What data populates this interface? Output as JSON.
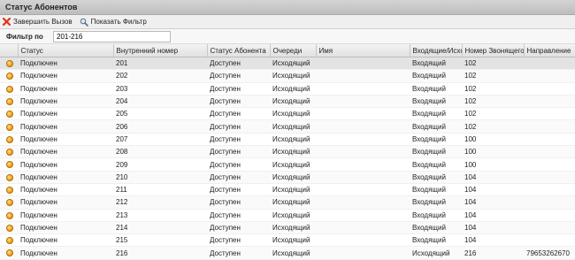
{
  "window": {
    "title": "Статус Абонентов"
  },
  "toolbar": {
    "end_call_label": "Завершить Вызов",
    "show_filter_label": "Показать Фильтр"
  },
  "filter": {
    "label": "Фильтр по",
    "value": "201-216"
  },
  "columns": [
    "Статус",
    "Внутренний номер",
    "Статус Абонента",
    "Очереди",
    "Имя",
    "Входящие/Исходящие",
    "Номер Звонящего",
    "Направление"
  ],
  "rows": [
    {
      "status": "Подключен",
      "ext": "201",
      "subscriber_status": "Доступен",
      "queue": "Исходящий",
      "name": "",
      "direction_type": "Входящий",
      "caller": "102",
      "destination": ""
    },
    {
      "status": "Подключен",
      "ext": "202",
      "subscriber_status": "Доступен",
      "queue": "Исходящий",
      "name": "",
      "direction_type": "Входящий",
      "caller": "102",
      "destination": ""
    },
    {
      "status": "Подключен",
      "ext": "203",
      "subscriber_status": "Доступен",
      "queue": "Исходящий",
      "name": "",
      "direction_type": "Входящий",
      "caller": "102",
      "destination": ""
    },
    {
      "status": "Подключен",
      "ext": "204",
      "subscriber_status": "Доступен",
      "queue": "Исходящий",
      "name": "",
      "direction_type": "Входящий",
      "caller": "102",
      "destination": ""
    },
    {
      "status": "Подключен",
      "ext": "205",
      "subscriber_status": "Доступен",
      "queue": "Исходящий",
      "name": "",
      "direction_type": "Входящий",
      "caller": "102",
      "destination": ""
    },
    {
      "status": "Подключен",
      "ext": "206",
      "subscriber_status": "Доступен",
      "queue": "Исходящий",
      "name": "",
      "direction_type": "Входящий",
      "caller": "102",
      "destination": ""
    },
    {
      "status": "Подключен",
      "ext": "207",
      "subscriber_status": "Доступен",
      "queue": "Исходящий",
      "name": "",
      "direction_type": "Входящий",
      "caller": "100",
      "destination": ""
    },
    {
      "status": "Подключен",
      "ext": "208",
      "subscriber_status": "Доступен",
      "queue": "Исходящий",
      "name": "",
      "direction_type": "Входящий",
      "caller": "100",
      "destination": ""
    },
    {
      "status": "Подключен",
      "ext": "209",
      "subscriber_status": "Доступен",
      "queue": "Исходящий",
      "name": "",
      "direction_type": "Входящий",
      "caller": "100",
      "destination": ""
    },
    {
      "status": "Подключен",
      "ext": "210",
      "subscriber_status": "Доступен",
      "queue": "Исходящий",
      "name": "",
      "direction_type": "Входящий",
      "caller": "104",
      "destination": ""
    },
    {
      "status": "Подключен",
      "ext": "211",
      "subscriber_status": "Доступен",
      "queue": "Исходящий",
      "name": "",
      "direction_type": "Входящий",
      "caller": "104",
      "destination": ""
    },
    {
      "status": "Подключен",
      "ext": "212",
      "subscriber_status": "Доступен",
      "queue": "Исходящий",
      "name": "",
      "direction_type": "Входящий",
      "caller": "104",
      "destination": ""
    },
    {
      "status": "Подключен",
      "ext": "213",
      "subscriber_status": "Доступен",
      "queue": "Исходящий",
      "name": "",
      "direction_type": "Входящий",
      "caller": "104",
      "destination": ""
    },
    {
      "status": "Подключен",
      "ext": "214",
      "subscriber_status": "Доступен",
      "queue": "Исходящий",
      "name": "",
      "direction_type": "Входящий",
      "caller": "104",
      "destination": ""
    },
    {
      "status": "Подключен",
      "ext": "215",
      "subscriber_status": "Доступен",
      "queue": "Исходящий",
      "name": "",
      "direction_type": "Входящий",
      "caller": "104",
      "destination": ""
    },
    {
      "status": "Подключен",
      "ext": "216",
      "subscriber_status": "Доступен",
      "queue": "Исходящий",
      "name": "",
      "direction_type": "Исходящий",
      "caller": "216",
      "destination": "79653262670"
    }
  ],
  "colors": {
    "status_dot": "#f0a31c",
    "end_call_icon": "#e0351b",
    "selected_row": "#e3e3e3"
  },
  "icons": {
    "end_call": "red-x-icon",
    "show_filter": "filter-magnifier-icon",
    "row_status": "orange-dot-icon"
  }
}
